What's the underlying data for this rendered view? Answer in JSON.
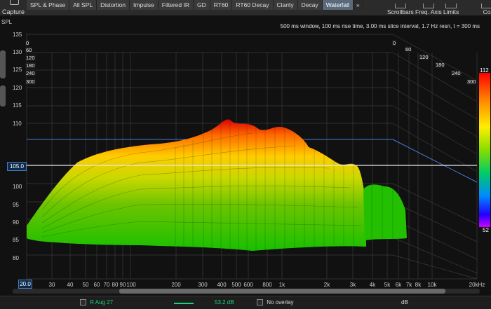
{
  "toolbar": {
    "capture_label": "Capture",
    "tabs": [
      "SPL & Phase",
      "All SPL",
      "Distortion",
      "Impulse",
      "Filtered IR",
      "GD",
      "RT60",
      "RT60 Decay",
      "Clarity",
      "Decay",
      "Waterfall",
      "»"
    ],
    "active_tab": "Waterfall",
    "right_buttons": [
      "Scrollbars",
      "Freq. Axis",
      "Limits",
      "Co"
    ]
  },
  "plot": {
    "info": "500 ms window, 100 ms rise time, 3.00 ms slice interval, 1.7 Hz resn, t = 300 ms",
    "y_axis_label": "SPL",
    "y_ticks": [
      "135",
      "130",
      "125",
      "120",
      "115",
      "110",
      "105",
      "100",
      "95",
      "90",
      "85",
      "80"
    ],
    "x_ticks": [
      "30",
      "40",
      "50",
      "60",
      "70",
      "80",
      "90",
      "100",
      "200",
      "300",
      "400",
      "500",
      "600",
      "800",
      "1k",
      "2k",
      "3k",
      "4k",
      "5k",
      "6k",
      "7k",
      "8k",
      "10k",
      "20kHz"
    ],
    "x_start": "20.0",
    "y_marker": "105.0",
    "time_labels_left": [
      "0",
      "60",
      "120",
      "180",
      "240",
      "300"
    ],
    "time_labels_right": [
      "0",
      "60",
      "120",
      "180",
      "240",
      "300"
    ],
    "colorbar_max": "112",
    "colorbar_min": "52"
  },
  "status": {
    "measurement": "R Aug 27",
    "value": "53.2 dB",
    "overlay": "No overlay",
    "unit": "dB"
  }
}
